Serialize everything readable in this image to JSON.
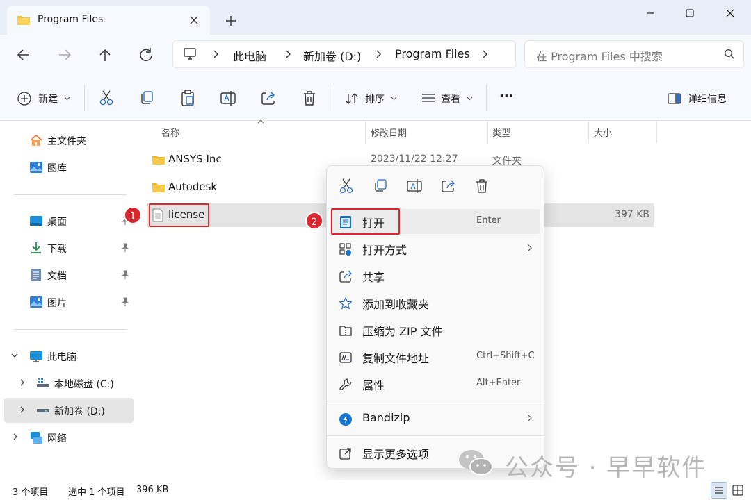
{
  "window": {
    "tab_title": "Program Files",
    "new_tab_symbol": "+"
  },
  "address": {
    "crumbs": [
      "此电脑",
      "新加卷 (D:)",
      "Program Files"
    ],
    "search_placeholder": "在 Program Files 中搜索"
  },
  "toolbar": {
    "new_label": "新建",
    "sort_label": "排序",
    "view_label": "查看",
    "more_label": "···",
    "details_label": "详细信息"
  },
  "sidebar": {
    "home": "主文件夹",
    "gallery": "图库",
    "desktop": "桌面",
    "downloads": "下载",
    "documents": "文档",
    "pictures": "图片",
    "this_pc": "此电脑",
    "drive_c": "本地磁盘 (C:)",
    "drive_d": "新加卷 (D:)",
    "network": "网络"
  },
  "columns": {
    "name": "名称",
    "modified": "修改日期",
    "type": "类型",
    "size": "大小"
  },
  "files": [
    {
      "name": "ANSYS Inc",
      "date": "2023/11/22 12:27",
      "type": "文件夹",
      "size": ""
    },
    {
      "name": "Autodesk",
      "date": "",
      "type": "",
      "size": ""
    },
    {
      "name": "license",
      "date": "",
      "type": "",
      "size": "397 KB"
    }
  ],
  "annotations": {
    "badge1": "1",
    "badge2": "2"
  },
  "context_menu": {
    "open": "打开",
    "open_key": "Enter",
    "open_with": "打开方式",
    "share": "共享",
    "add_fav": "添加到收藏夹",
    "zip": "压缩为 ZIP 文件",
    "copy_path": "复制文件地址",
    "copy_path_key": "Ctrl+Shift+C",
    "properties": "属性",
    "properties_key": "Alt+Enter",
    "bandizip": "Bandizip",
    "more": "显示更多选项"
  },
  "status": {
    "count": "3 个项目",
    "selected": "选中 1 个项目",
    "selected_size": "396 KB"
  },
  "watermark": "公众号 · 早早软件",
  "colors": {
    "accent": "#0067c0",
    "annotation_red": "#e0252b",
    "folder_yellow": "#f7c23c"
  }
}
